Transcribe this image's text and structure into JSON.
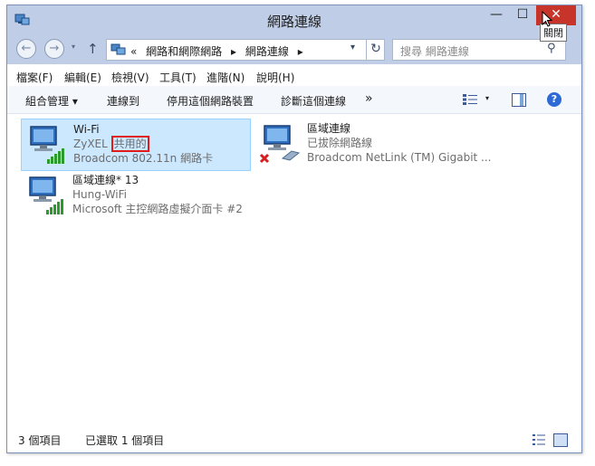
{
  "window": {
    "title": "網路連線",
    "minimize_glyph": "—",
    "maximize_glyph": "☐",
    "close_glyph": "✕",
    "close_tooltip": "關閉",
    "close_color": "#c7342a",
    "titlebar_color": "#bfcde6"
  },
  "address_bar": {
    "back_glyph": "←",
    "forward_glyph": "→",
    "up_glyph": "↑",
    "dropdown_glyph": "▾",
    "refresh_glyph": "↻",
    "breadcrumbs": [
      "«",
      "網路和網際網路",
      "▸",
      "網路連線",
      "▸"
    ]
  },
  "search": {
    "placeholder": "搜尋 網路連線",
    "icon": "search-icon"
  },
  "menu": {
    "file": "檔案(F)",
    "edit": "編輯(E)",
    "view": "檢視(V)",
    "tools": "工具(T)",
    "advanced": "進階(N)",
    "help": "說明(H)"
  },
  "commands": {
    "organize": "組合管理 ▾",
    "connect": "連線到",
    "disable": "停用這個網路裝置",
    "diagnose": "診斷這個連線",
    "more": "»",
    "help_glyph": "?"
  },
  "connections": [
    {
      "name": "Wi-Fi",
      "status_prefix": "ZyXEL",
      "status_shared": "共用的",
      "device": "Broadcom 802.11n 網路卡",
      "selected": true
    },
    {
      "name": "區域連線",
      "status": "已拔除網路線",
      "device": "Broadcom NetLink (TM) Gigabit ...",
      "selected": false
    },
    {
      "name": "區域連線* 13",
      "status": "Hung-WiFi",
      "device": "Microsoft 主控網路虛擬介面卡 #2",
      "selected": false
    }
  ],
  "status_bar": {
    "count": "3 個項目",
    "selected": "已選取 1 個項目"
  },
  "colors": {
    "selection_bg": "#cce8ff",
    "selection_border": "#99d1ff",
    "highlight_box": "#e11a1a",
    "help_blue": "#2d6ad6"
  }
}
